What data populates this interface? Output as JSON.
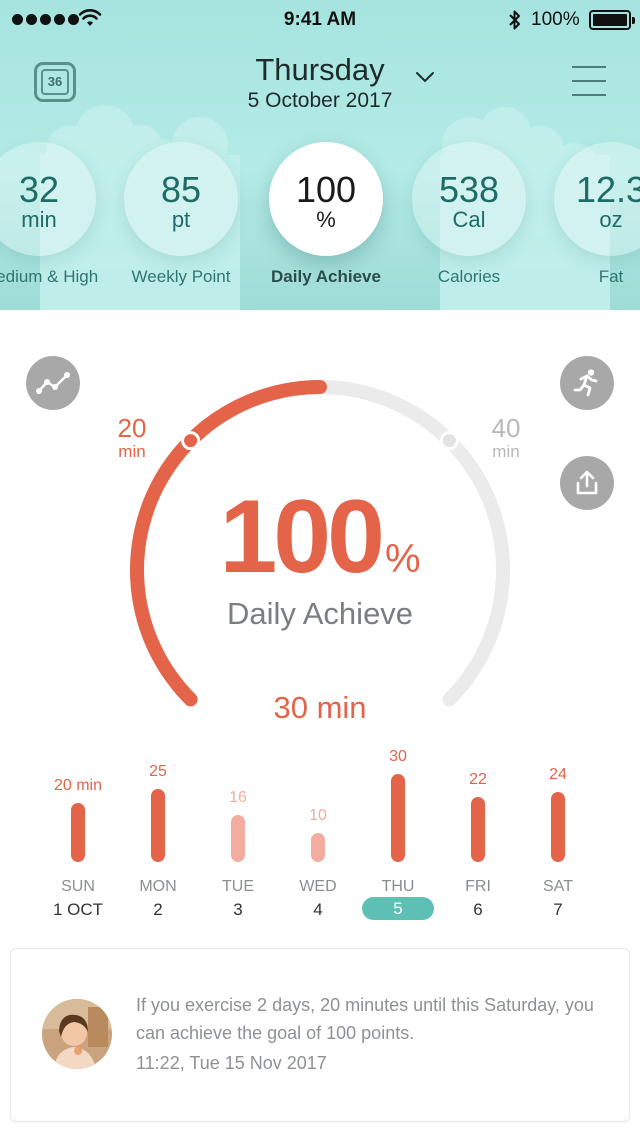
{
  "status_bar": {
    "time": "9:41 AM",
    "battery": "100%",
    "icons": [
      "signal-dots-icon",
      "wifi-icon",
      "bluetooth-icon",
      "battery-icon"
    ]
  },
  "header": {
    "calendar_badge": "36",
    "day": "Thursday",
    "date": "5 October 2017",
    "icons": [
      "calendar-icon",
      "chevron-down-icon",
      "menu-icon"
    ]
  },
  "metrics": [
    {
      "value": "32",
      "unit": "min",
      "label": "Medium & High"
    },
    {
      "value": "85",
      "unit": "pt",
      "label": "Weekly Point"
    },
    {
      "value": "100",
      "unit": "%",
      "label": "Daily Achieve"
    },
    {
      "value": "538",
      "unit": "Cal",
      "label": "Calories"
    },
    {
      "value": "12.3",
      "unit": "oz",
      "label": "Fat"
    }
  ],
  "gauge": {
    "progress_fraction": 0.5,
    "min_label": {
      "value": "20",
      "unit": "min"
    },
    "max_label": {
      "value": "40",
      "unit": "min"
    },
    "percent": "100",
    "percent_sign": "%",
    "caption": "Daily Achieve",
    "total": "30 min",
    "accent_color": "#e4644a",
    "track_color": "#ebebeb",
    "icons": [
      "trend-chart-icon",
      "running-icon",
      "share-icon"
    ]
  },
  "chart_data": {
    "type": "bar",
    "categories": [
      "SUN",
      "MON",
      "TUE",
      "WED",
      "THU",
      "FRI",
      "SAT"
    ],
    "dates": [
      "1 OCT",
      "2",
      "3",
      "4",
      "5",
      "6",
      "7"
    ],
    "values": [
      20,
      25,
      16,
      10,
      30,
      22,
      24
    ],
    "value_labels": [
      "20 min",
      "25",
      "16",
      "10",
      "30",
      "22",
      "24"
    ],
    "muted": [
      false,
      false,
      true,
      true,
      false,
      false,
      false
    ],
    "highlighted_index": 4,
    "ylim": [
      0,
      30
    ],
    "bar_color": "#e4644a",
    "muted_color": "#f2ada0",
    "highlight_color": "#5ec0b5"
  },
  "notification": {
    "message": "If you exercise 2 days, 20 minutes until this Saturday, you can achieve the goal of 100 points.",
    "timestamp": "11:22, Tue 15 Nov 2017"
  }
}
